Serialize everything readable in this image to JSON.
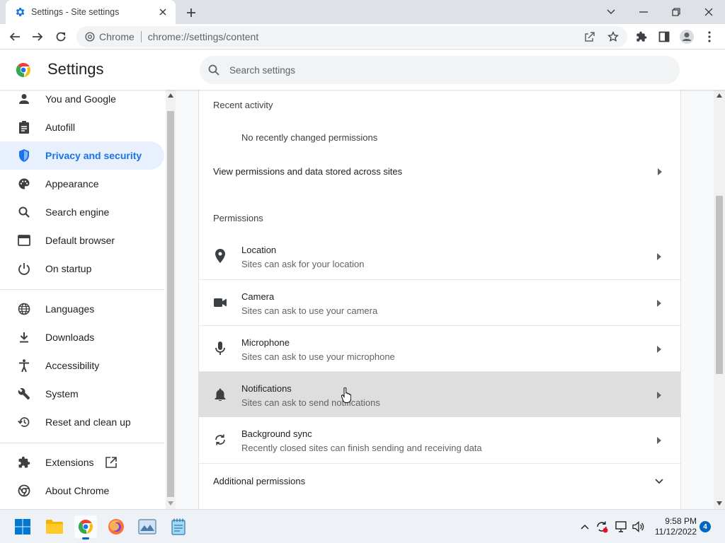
{
  "browser": {
    "tab_title": "Settings - Site settings",
    "omnibox_site": "Chrome",
    "omnibox_url": "chrome://settings/content"
  },
  "header": {
    "title": "Settings",
    "search_placeholder": "Search settings"
  },
  "sidebar": {
    "items": [
      {
        "label": "You and Google",
        "icon": "person-icon"
      },
      {
        "label": "Autofill",
        "icon": "clipboard-icon"
      },
      {
        "label": "Privacy and security",
        "icon": "shield-icon",
        "active": true
      },
      {
        "label": "Appearance",
        "icon": "palette-icon"
      },
      {
        "label": "Search engine",
        "icon": "search-icon"
      },
      {
        "label": "Default browser",
        "icon": "browser-window-icon"
      },
      {
        "label": "On startup",
        "icon": "power-icon"
      },
      {
        "label": "Languages",
        "icon": "globe-icon"
      },
      {
        "label": "Downloads",
        "icon": "download-icon"
      },
      {
        "label": "Accessibility",
        "icon": "accessibility-icon"
      },
      {
        "label": "System",
        "icon": "wrench-icon"
      },
      {
        "label": "Reset and clean up",
        "icon": "restore-icon"
      },
      {
        "label": "Extensions",
        "icon": "puzzle-icon"
      },
      {
        "label": "About Chrome",
        "icon": "chrome-icon"
      }
    ]
  },
  "main": {
    "recent_heading": "Recent activity",
    "recent_empty": "No recently changed permissions",
    "view_permissions": "View permissions and data stored across sites",
    "permissions_heading": "Permissions",
    "permissions": [
      {
        "title": "Location",
        "subtitle": "Sites can ask for your location",
        "icon": "location-pin-icon"
      },
      {
        "title": "Camera",
        "subtitle": "Sites can ask to use your camera",
        "icon": "camera-icon"
      },
      {
        "title": "Microphone",
        "subtitle": "Sites can ask to use your microphone",
        "icon": "microphone-icon"
      },
      {
        "title": "Notifications",
        "subtitle": "Sites can ask to send notifications",
        "icon": "bell-icon",
        "hovered": true
      },
      {
        "title": "Background sync",
        "subtitle": "Recently closed sites can finish sending and receiving data",
        "icon": "sync-icon"
      }
    ],
    "additional_permissions": "Additional permissions"
  },
  "taskbar": {
    "time": "9:58 PM",
    "date": "11/12/2022",
    "notification_count": "4"
  },
  "colors": {
    "accent": "#1a73e8",
    "active_bg": "#e8f0fe",
    "hover_row": "#dedede"
  }
}
